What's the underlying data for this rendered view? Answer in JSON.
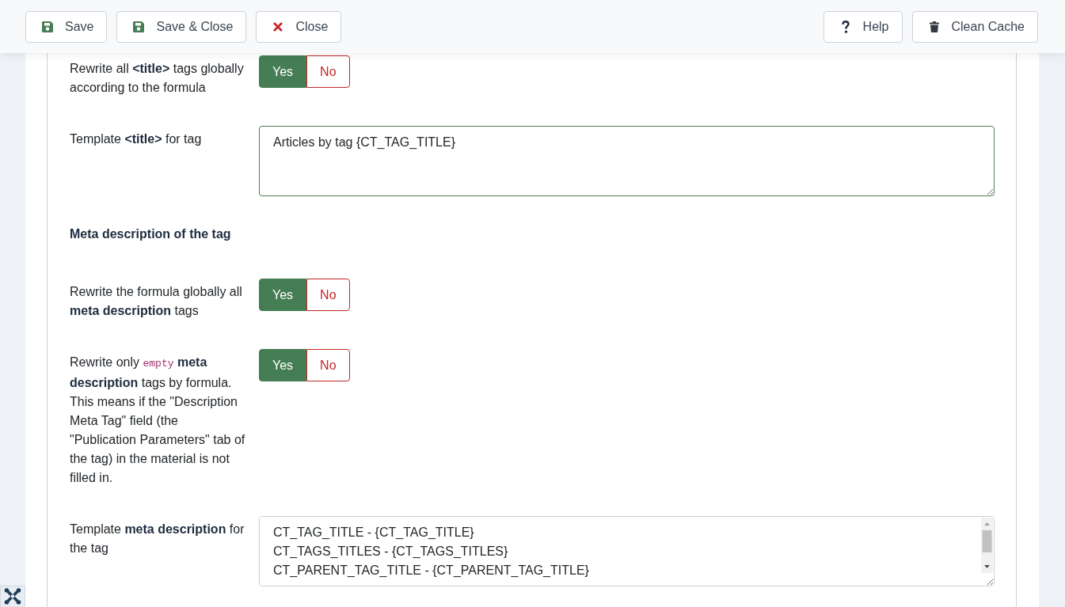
{
  "toolbar": {
    "left_buttons": [
      {
        "label": "Save",
        "kind": "save"
      },
      {
        "label": "Save & Close",
        "kind": "save"
      },
      {
        "label": "Close",
        "kind": "close"
      }
    ],
    "right_buttons": [
      {
        "label": "Help",
        "kind": "help"
      },
      {
        "label": "Clean Cache",
        "kind": "trash"
      }
    ]
  },
  "form": {
    "rows": [
      {
        "kind": "toggle",
        "label": [
          {
            "kind": "text",
            "text": "Rewrite all **<title>** tags globally according to the formula"
          }
        ],
        "options": [
          {
            "label": "Yes",
            "selected": true
          },
          {
            "label": "No",
            "selected": false
          }
        ]
      },
      {
        "kind": "textarea",
        "label": [
          {
            "kind": "text",
            "text": "Template **<title>** for tag"
          }
        ],
        "lines": [
          "Articles by tag {CT_TAG_TITLE}"
        ],
        "valid": true
      },
      {
        "kind": "heading",
        "text": "Meta description of the tag"
      },
      {
        "kind": "toggle",
        "label": [
          {
            "kind": "text",
            "text": "Rewrite the formula globally all **meta description** tags"
          }
        ],
        "options": [
          {
            "label": "Yes",
            "selected": true
          },
          {
            "label": "No",
            "selected": false
          }
        ]
      },
      {
        "kind": "toggle",
        "label": [
          {
            "kind": "text",
            "text": "Rewrite only"
          },
          {
            "kind": "code",
            "text": "empty"
          },
          {
            "kind": "text",
            "text": "**meta description** tags by formula. This means if the \"Description Meta Tag\" field (the \"Publication Parameters\" tab of the tag) in the material is not filled in."
          }
        ],
        "options": [
          {
            "label": "Yes",
            "selected": true
          },
          {
            "label": "No",
            "selected": false
          }
        ]
      },
      {
        "kind": "textarea",
        "label": [
          {
            "kind": "text",
            "text": "Template **meta description** for the tag"
          }
        ],
        "lines": [
          "CT_TAG_TITLE - {CT_TAG_TITLE}",
          "CT_TAGS_TITLES - {CT_TAGS_TITLES}",
          "CT_PARENT_TAG_TITLE - {CT_PARENT_TAG_TITLE}"
        ],
        "valid": false
      }
    ]
  }
}
